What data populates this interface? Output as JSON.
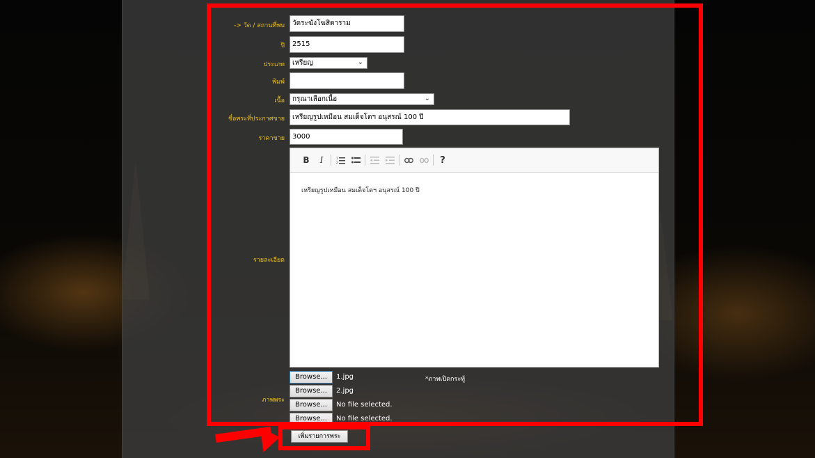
{
  "form": {
    "temple_label": "-> วัด / สถานที่พบ",
    "temple_value": "วัดระฆังโฆสิตาราม",
    "year_label": "ปี",
    "year_value": "2515",
    "type_label": "ประเภท",
    "type_value": "เหรียญ",
    "print_label": "พิมพ์",
    "print_value": "",
    "material_label": "เนื้อ",
    "material_value": "กรุณาเลือกเนื้อ",
    "name_label": "ชื่อพระที่ประกาศขาย",
    "name_value": "เหรียญรูปเหมือน สมเด็จโตฯ อนุสรณ์ 100 ปี",
    "price_label": "ราคาขาย",
    "price_value": "3000",
    "detail_label": "รายละเอียด",
    "detail_text": "เหรียญรูปเหมือน สมเด็จโตฯ อนุสรณ์ 100 ปี",
    "images_label": "ภาพพระ",
    "browse_label": "Browse...",
    "files": [
      "1.jpg",
      "2.jpg",
      "No file selected.",
      "No file selected."
    ],
    "cover_note": "*ภาพเปิดกระทู้",
    "submit_label": "เพิ่มรายการพระ"
  },
  "toolbar": {
    "bold": "B",
    "italic": "I",
    "help": "?"
  },
  "icons": [
    "bold-icon",
    "italic-icon",
    "numbered-list-icon",
    "bullet-list-icon",
    "outdent-icon",
    "indent-icon",
    "link-icon",
    "unlink-icon",
    "help-icon",
    "chevron-down-icon"
  ],
  "colors": {
    "label": "#f0c419",
    "highlight": "#ff0000",
    "panel": "#3a3a3a"
  }
}
